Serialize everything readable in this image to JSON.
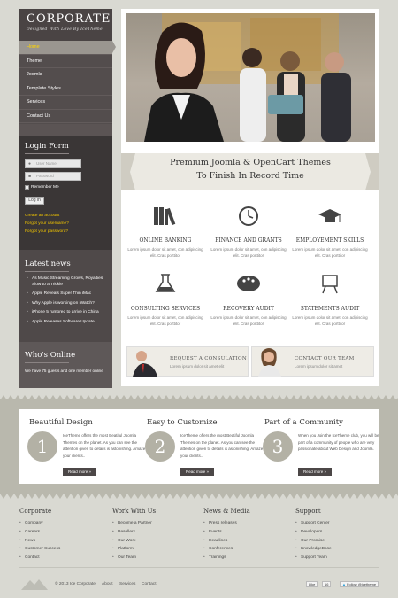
{
  "brand": {
    "title": "CORPORATE",
    "tagline": "Designed With Love By IceTheme"
  },
  "menu": [
    {
      "label": "Home",
      "active": true
    },
    {
      "label": "Theme"
    },
    {
      "label": "Joomla"
    },
    {
      "label": "Template Styles"
    },
    {
      "label": "Services"
    },
    {
      "label": "Contact Us"
    }
  ],
  "login": {
    "heading": "Login Form",
    "username_placeholder": "User Name",
    "password_placeholder": "Password",
    "remember_label": "Remember Me",
    "login_button": "Log in",
    "links": [
      "Create an account",
      "Forgot your username?",
      "Forgot your password?"
    ]
  },
  "latest_news": {
    "heading": "Latest news",
    "items": [
      "As Music Streaming Grows, Royalties Slow to a Trickle",
      "Apple Reveals Super Thin iMac",
      "Why Apple is working on iWatch?",
      "iPhone 5 rumored to arrive in China",
      "Apple Releases Software Update"
    ]
  },
  "whos_online": {
    "heading": "Who's Online",
    "text": "We have 75 guests and one member online"
  },
  "banner": {
    "line1": "Premium Joomla & OpenCart Themes",
    "line2": "To Finish In Record Time"
  },
  "features": [
    {
      "icon": "books-icon",
      "title": "ONLINE BANKING",
      "desc": "Lorem ipsum dolor sit amet, con adipiscing elit. Cras porttitor"
    },
    {
      "icon": "clock-icon",
      "title": "FINANCE AND GRANTS",
      "desc": "Lorem ipsum dolor sit amet, con adipiscing elit. Cras porttitor"
    },
    {
      "icon": "graduation-cap-icon",
      "title": "EMPLOYEMENT SKILLS",
      "desc": "Lorem ipsum dolor sit amet, con adipiscing elit. Cras porttitor"
    },
    {
      "icon": "flask-icon",
      "title": "CONSULTING SERVICES",
      "desc": "Lorem ipsum dolor sit amet, con adipiscing elit. Cras porttitor"
    },
    {
      "icon": "palette-icon",
      "title": "RECOVERY AUDIT",
      "desc": "Lorem ipsum dolor sit amet, con adipiscing elit. Cras porttitor"
    },
    {
      "icon": "easel-icon",
      "title": "STATEMENTS AUDIT",
      "desc": "Lorem ipsum dolor sit amet, con adipiscing elit. Cras porttitor"
    }
  ],
  "promos": [
    {
      "title": "REQUEST A CONSULATION",
      "desc": "Lorem ipsum dolor sit amet elit"
    },
    {
      "title": "CONTACT OUR TEAM",
      "desc": "Lorem ipsum dolor sit amet"
    }
  ],
  "steps": [
    {
      "number": "1",
      "title": "Beautiful Design",
      "text": "IceTheme offers the most Beatiful Joomla Themes on the planet. As you can see the attention given to details is astonishing. Amaze your clients..",
      "button": "Read more »"
    },
    {
      "number": "2",
      "title": "Easy to Customize",
      "text": "IceTheme offers the most Beatiful Joomla Themes on the planet. As you can see the attention given to details is astonishing. Amaze your clients..",
      "button": "Read more »"
    },
    {
      "number": "3",
      "title": "Part of a Community",
      "text": "When you Join the IceTheme club, you will be part of a community of people who are very passionate about Web Design and Joomla.",
      "button": "Read more »"
    }
  ],
  "footer_columns": [
    {
      "title": "Corporate",
      "items": [
        "Company",
        "Careers",
        "News",
        "Customer Success",
        "Contact"
      ]
    },
    {
      "title": "Work With Us",
      "items": [
        "Become a Partner",
        "Resellers",
        "Our Work",
        "Platform",
        "Our Team"
      ]
    },
    {
      "title": "News & Media",
      "items": [
        "Press releases",
        "Events",
        "Headlines",
        "Conferences",
        "Trainings"
      ]
    },
    {
      "title": "Support",
      "items": [
        "Support Center",
        "Developers",
        "Our Promise",
        "KnowledgeBase",
        "Support Team"
      ]
    }
  ],
  "bottom": {
    "copyright": "© 2013 Ice Corporate",
    "links": [
      "About",
      "Services",
      "Contact"
    ],
    "like_label": "Like",
    "like_count": "16",
    "follow_label": "Follow @icetheme"
  },
  "colors": {
    "sidebar": "#534d4d",
    "accent": "#ffd500",
    "band": "#b9b8ad",
    "background": "#d9d9d2"
  }
}
